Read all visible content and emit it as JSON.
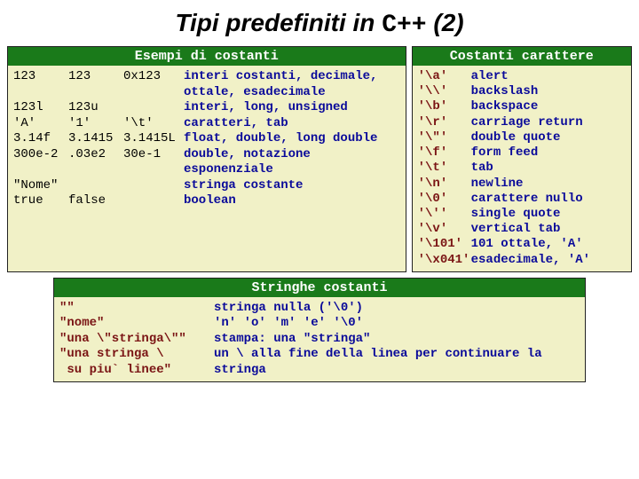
{
  "title_prefix": "Tipi predefiniti in ",
  "title_lang": "C++",
  "title_suffix": " (2)",
  "headers": {
    "examples": "Esempi di costanti",
    "char": "Costanti carattere",
    "strings": "Stringhe costanti"
  },
  "examples": [
    {
      "c0": "123",
      "c1": "123",
      "c2": "0x123",
      "desc": "interi costanti, decimale, ottale, esadecimale"
    },
    {
      "c0": "123l",
      "c1": "123u",
      "c2": "",
      "desc": "interi, long, unsigned"
    },
    {
      "c0": "'A'",
      "c1": "'1'",
      "c2": "'\\t'",
      "desc": "caratteri, tab"
    },
    {
      "c0": "3.14f",
      "c1": "3.1415",
      "c2": "3.1415L",
      "desc": "float, double, long double"
    },
    {
      "c0": "300e-2",
      "c1": ".03e2",
      "c2": "30e-1",
      "desc": "double, notazione esponenziale"
    },
    {
      "c0": "\"Nome\"",
      "c1": "",
      "c2": "",
      "desc": "stringa costante"
    },
    {
      "c0": "true",
      "c1": "false",
      "c2": "",
      "desc": "boolean"
    }
  ],
  "chars": [
    {
      "esc": "'\\a'",
      "desc": "alert"
    },
    {
      "esc": "'\\\\'",
      "desc": "backslash"
    },
    {
      "esc": "'\\b'",
      "desc": "backspace"
    },
    {
      "esc": "'\\r'",
      "desc": "carriage return"
    },
    {
      "esc": "'\\\"'",
      "desc": "double quote"
    },
    {
      "esc": "'\\f'",
      "desc": "form feed"
    },
    {
      "esc": "'\\t'",
      "desc": "tab"
    },
    {
      "esc": "'\\n'",
      "desc": "newline"
    },
    {
      "esc": "'\\0'",
      "desc": "carattere nullo"
    },
    {
      "esc": "'\\''",
      "desc": "single quote"
    },
    {
      "esc": "'\\v'",
      "desc": "vertical tab"
    },
    {
      "esc": "'\\101'",
      "desc": "101 ottale, 'A'"
    },
    {
      "esc": "'\\x041'",
      "desc": "esadecimale, 'A'"
    }
  ],
  "strings": [
    {
      "lit": "\"\"",
      "desc": "stringa nulla ('\\0')"
    },
    {
      "lit": "\"nome\"",
      "desc": "'n' 'o' 'm' 'e' '\\0'"
    },
    {
      "lit": "\"una \\\"stringa\\\"\"",
      "desc": "stampa: una \"stringa\""
    },
    {
      "lit": "\"una stringa \\\n su piu` linee\"",
      "desc": "un \\ alla fine della linea per continuare la stringa"
    }
  ]
}
